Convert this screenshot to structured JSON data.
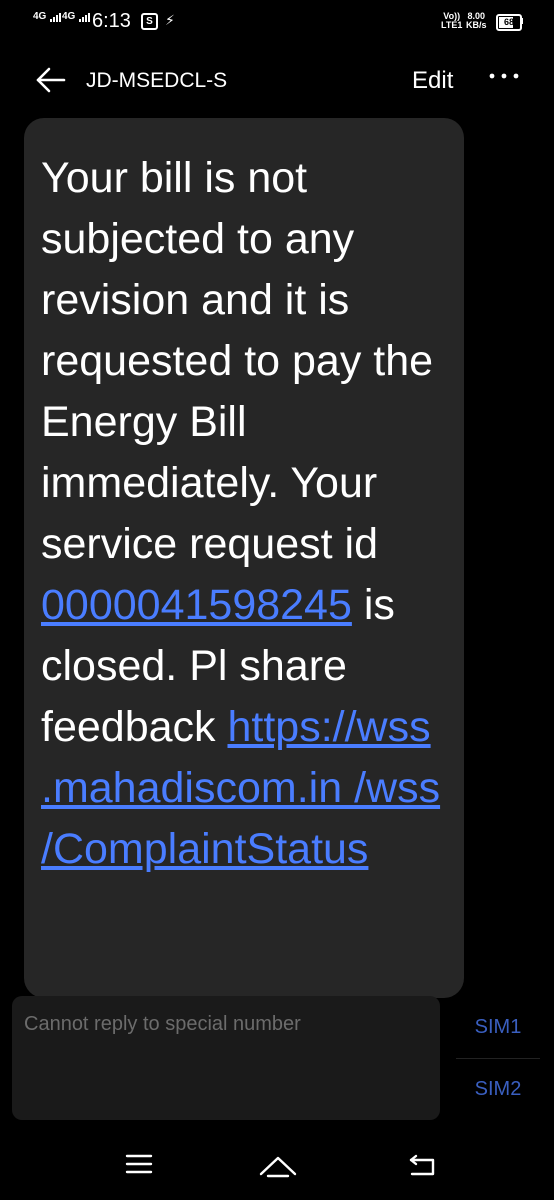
{
  "status_bar": {
    "network1": "4G",
    "network2": "4G",
    "time": "6:13",
    "app_icon_letter": "S",
    "volte_line1": "Vo))",
    "volte_line2": "LTE1",
    "speed_value": "8.00",
    "speed_unit": "KB/s",
    "battery": "68"
  },
  "header": {
    "title": "JD-MSEDCL-S",
    "edit_label": "Edit",
    "back_icon": "arrow-left-icon",
    "more_icon": "more-horizontal-icon"
  },
  "message": {
    "text_part1": "Your bill is not subjected to any revision and it is requested to pay the Energy Bill immediately. Your service request id",
    "request_id": "0000041598245",
    "text_part2": "is closed. Pl share feedback",
    "link": "https://wss .mahadiscom.in /wss /ComplaintStatus"
  },
  "reply": {
    "placeholder": "Cannot reply to special number",
    "sim1_label": "SIM1",
    "sim2_label": "SIM2"
  },
  "nav": {
    "menu_icon": "menu-icon",
    "home_icon": "home-icon",
    "back_icon": "back-return-icon"
  },
  "colors": {
    "background": "#000000",
    "bubble": "#262626",
    "link": "#4a7dff",
    "sim_text": "#3a5fc0"
  }
}
